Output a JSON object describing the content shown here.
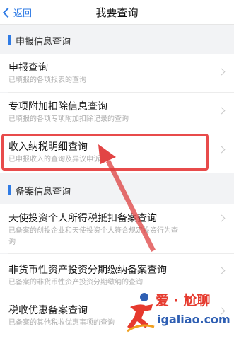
{
  "nav": {
    "back_label": "返回",
    "title": "我要查询"
  },
  "sections": [
    {
      "title": "申报信息查询",
      "items": [
        {
          "title": "申报查询",
          "subtitle": "已填报的各项报表的查询"
        },
        {
          "title": "专项附加扣除信息查询",
          "subtitle": "已填报的各项专项附加扣除记录的查询"
        },
        {
          "title": "收入纳税明细查询",
          "subtitle": "已申报收入的查询及异议申诉"
        }
      ]
    },
    {
      "title": "备案信息查询",
      "items": [
        {
          "title": "天使投资个人所得税抵扣备案查询",
          "subtitle_line1": "已备案的创投企业和天使投资个人符合规定投资行为查",
          "subtitle_line2": "询"
        },
        {
          "title": "非货币性资产投资分期缴纳备案查询",
          "subtitle": "已备案的非货币性资产投资分期缴纳的查询"
        },
        {
          "title": "税收优惠备案查询",
          "subtitle": "已备案的其他税收优惠事项的查询"
        }
      ]
    }
  ],
  "watermark": {
    "brand": "爱 · 尬聊",
    "domain": "igaliao.com"
  },
  "colors": {
    "accent": "#2f7be5",
    "highlight": "#e84b4b",
    "watermark_red": "#e63a2e",
    "watermark_blue": "#2f5fb3"
  }
}
